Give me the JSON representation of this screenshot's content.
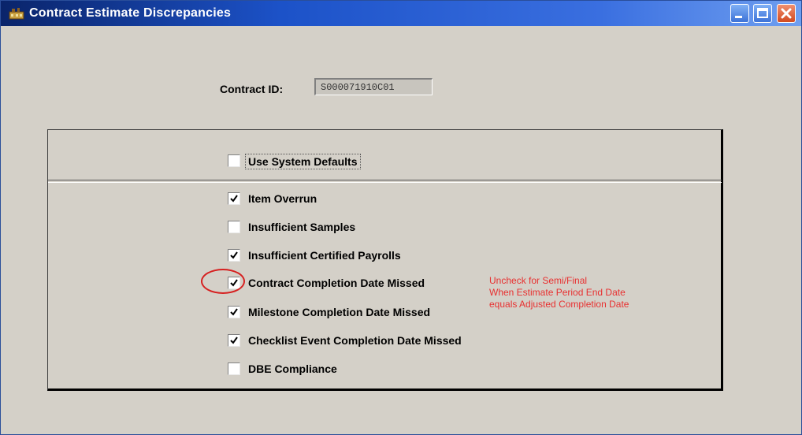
{
  "window": {
    "title": "Contract Estimate Discrepancies",
    "app_icon": "app-icon"
  },
  "titlebar_buttons": [
    "minimize-button",
    "maximize-button",
    "close-button"
  ],
  "contract": {
    "label": "Contract ID:",
    "value": "S000071910C01"
  },
  "defaults": {
    "label": "Use System Defaults",
    "checked": false
  },
  "discrepancies": [
    {
      "label": "Item Overrun",
      "checked": true
    },
    {
      "label": "Insufficient Samples",
      "checked": false
    },
    {
      "label": "Insufficient Certified Payrolls",
      "checked": true
    },
    {
      "label": "Contract Completion Date Missed",
      "checked": true
    },
    {
      "label": "Milestone Completion Date Missed",
      "checked": true
    },
    {
      "label": "Checklist Event Completion Date Missed",
      "checked": true
    },
    {
      "label": "DBE Compliance",
      "checked": false
    }
  ],
  "annotation": {
    "lines": [
      "Uncheck for Semi/Final",
      "When Estimate Period End Date",
      "equals Adjusted Completion Date"
    ],
    "color": "#e83030"
  },
  "colors": {
    "titlebar": "#0a246a",
    "window_bg": "#d4d0c8",
    "highlight_circle": "#d62020"
  }
}
